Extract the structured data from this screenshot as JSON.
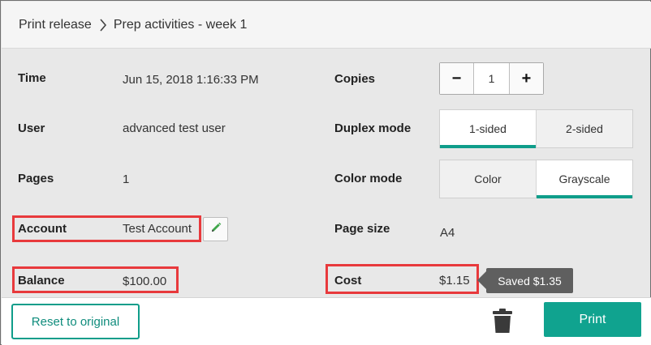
{
  "breadcrumb": {
    "root": "Print release",
    "current": "Prep activities - week 1"
  },
  "details": {
    "time": {
      "label": "Time",
      "value": "Jun 15, 2018 1:16:33 PM"
    },
    "user": {
      "label": "User",
      "value": "advanced test user"
    },
    "pages": {
      "label": "Pages",
      "value": "1"
    },
    "account": {
      "label": "Account",
      "value": "Test Account",
      "edit_icon": "pencil-icon"
    },
    "balance": {
      "label": "Balance",
      "value": "$100.00"
    }
  },
  "options": {
    "copies": {
      "label": "Copies",
      "value": "1",
      "decrement": "−",
      "increment": "+"
    },
    "duplex": {
      "label": "Duplex mode",
      "options": [
        "1-sided",
        "2-sided"
      ],
      "selected": "1-sided"
    },
    "color": {
      "label": "Color mode",
      "options": [
        "Color",
        "Grayscale"
      ],
      "selected": "Grayscale"
    },
    "page_size": {
      "label": "Page size",
      "value": "A4"
    },
    "cost": {
      "label": "Cost",
      "value": "$1.15",
      "saved": "Saved $1.35"
    }
  },
  "footer": {
    "reset_label": "Reset to original",
    "delete_icon": "trash-icon",
    "print_label": "Print"
  },
  "colors": {
    "accent": "#10a38f",
    "highlight": "#e8393c",
    "tooltip": "#5f5f5f"
  }
}
